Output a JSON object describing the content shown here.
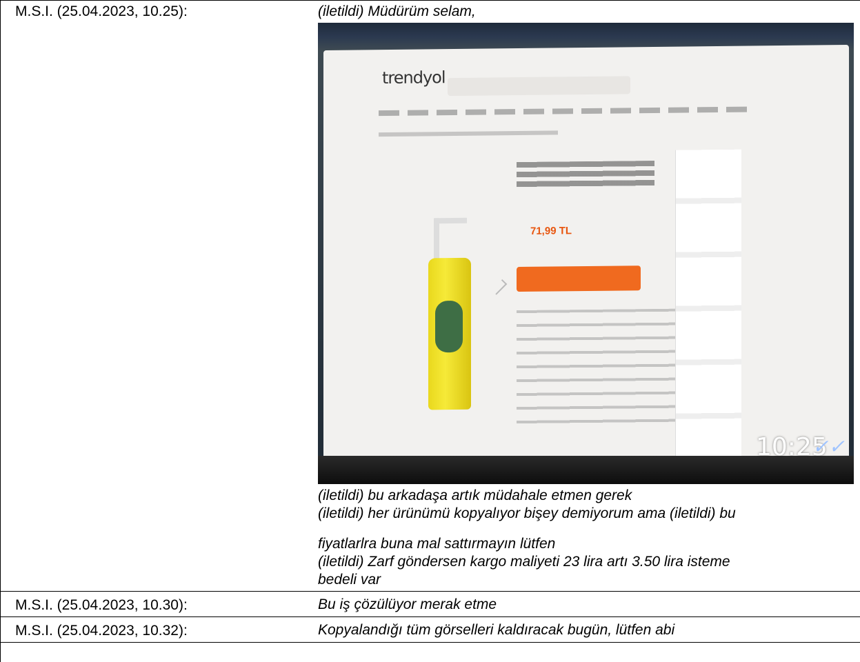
{
  "rows": [
    {
      "sender": "M.S.I. (25.04.2023, 10.25):",
      "top_line": "(iletildi) Müdürüm selam,",
      "lines": [
        "(iletildi) bu arkadaşa artık müdahale etmen gerek",
        "(iletildi) her ürünümü kopyalıyor bişey demiyorum ama (iletildi) bu",
        "fiyatlarlra buna mal sattırmayın lütfen",
        "(iletildi) Zarf göndersen kargo maliyeti 23 lira artı 3.50 lira isteme",
        "bedeli var"
      ]
    },
    {
      "sender": "M.S.I. (25.04.2023, 10.30):",
      "message": "Bu iş çözülüyor merak etme"
    },
    {
      "sender": "M.S.I. (25.04.2023, 10.32):",
      "message": "Kopyalandığı tüm görselleri kaldıracak bugün, lütfen abi"
    }
  ],
  "photo": {
    "site_logo": "trendyol",
    "price": "71,99 TL",
    "clock": "10:25",
    "ticks": "✓✓"
  }
}
